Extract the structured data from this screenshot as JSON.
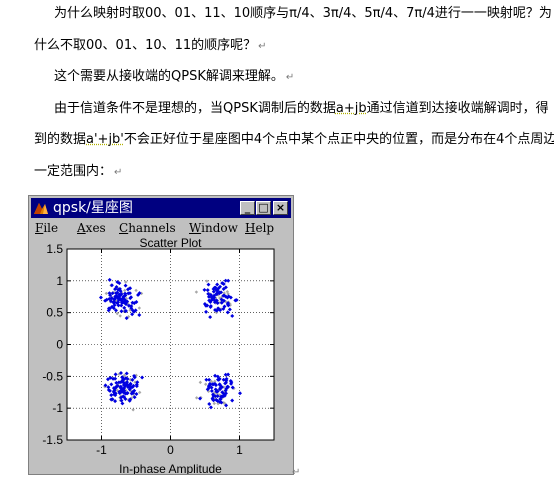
{
  "paragraphs": [
    {
      "text": "为什么映射时取00、01、11、10顺序与π/4、3π/4、5π/4、7π/4进行一一映射呢？为",
      "mark": ""
    },
    {
      "text": "什么不取00、01、10、11的顺序呢？",
      "mark": "↵"
    },
    {
      "text": "这个需要从接收端的QPSK解调来理解。",
      "mark": "↵"
    },
    {
      "text_a": "由于信道条件不是理想的，当QPSK调制后的数据",
      "text_u": "a+jb",
      "text_b": "通过信道到达接收端解调时，得",
      "mark": ""
    },
    {
      "text_a": "到的数据",
      "text_u": "a'+jb'",
      "text_b": "不会正好位于星座图中4个点中某个点正中央的位置，而是分布在4个点周边",
      "mark": ""
    },
    {
      "text": "一定范围内：",
      "mark": "↵"
    }
  ],
  "end_mark": "↵",
  "window": {
    "title": "qpsk/星座图",
    "buttons": {
      "minimize": "_",
      "maximize": "□",
      "close": "×"
    },
    "menu": [
      {
        "acc": "F",
        "rest": "ile"
      },
      {
        "acc": "A",
        "rest": "xes"
      },
      {
        "acc": "C",
        "rest": "hannels"
      },
      {
        "acc": "W",
        "rest": "indow"
      },
      {
        "acc": "H",
        "rest": "elp"
      }
    ]
  },
  "chart_data": {
    "type": "scatter",
    "title": "Scatter Plot",
    "xlabel": "In-phase Amplitude",
    "ylabel": "",
    "xlim": [
      -1.5,
      1.5
    ],
    "ylim": [
      -1.5,
      1.5
    ],
    "x_ticks": [
      -1,
      0,
      1
    ],
    "y_ticks": [
      1.5,
      1,
      0.5,
      0,
      -0.5,
      -1,
      -1.5
    ],
    "grid": true,
    "clusters": [
      {
        "cx": 0.707,
        "cy": 0.707,
        "spread": 0.12,
        "count": 70
      },
      {
        "cx": -0.707,
        "cy": 0.707,
        "spread": 0.12,
        "count": 90
      },
      {
        "cx": -0.707,
        "cy": -0.707,
        "spread": 0.12,
        "count": 90
      },
      {
        "cx": 0.707,
        "cy": -0.707,
        "spread": 0.12,
        "count": 70
      }
    ],
    "colors": {
      "points": "#0000e0",
      "faded": "#a8a8a8",
      "background": "#ffffff",
      "grid": "#000000"
    }
  }
}
